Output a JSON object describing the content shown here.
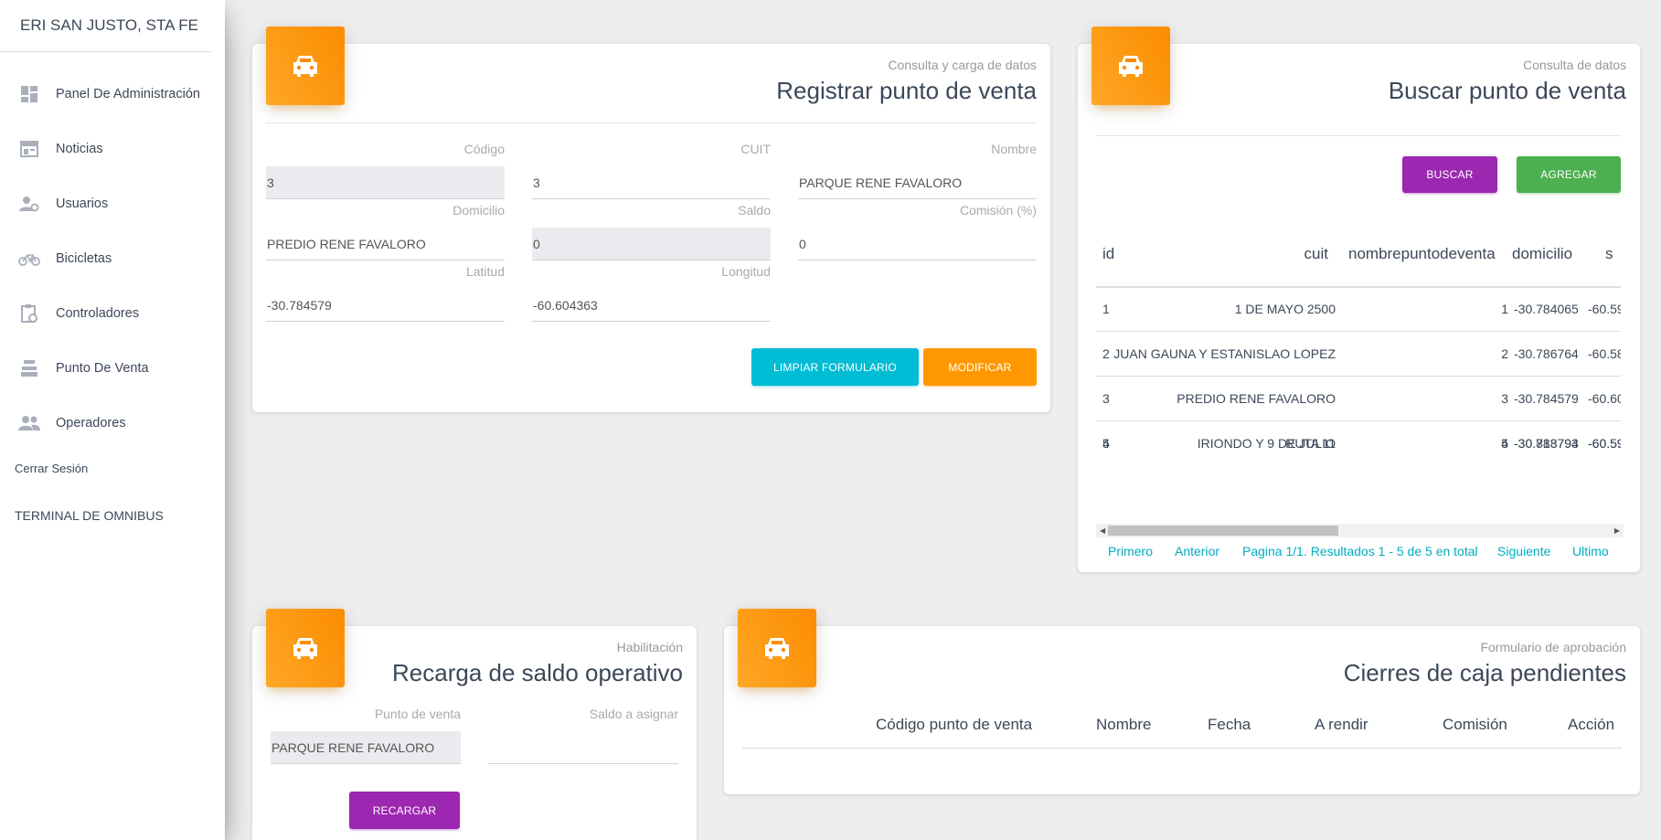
{
  "sidebar": {
    "brand": "ERI SAN JUSTO, STA FE",
    "items": [
      {
        "label": "Panel De Administración",
        "icon": "dashboard-icon"
      },
      {
        "label": "Noticias",
        "icon": "news-icon"
      },
      {
        "label": "Usuarios",
        "icon": "user-settings-icon"
      },
      {
        "label": "Bicicletas",
        "icon": "bicycle-icon"
      },
      {
        "label": "Controladores",
        "icon": "clipboard-clock-icon"
      },
      {
        "label": "Punto De Venta",
        "icon": "cash-register-icon"
      },
      {
        "label": "Operadores",
        "icon": "people-icon"
      }
    ],
    "logout": "Cerrar Sesión",
    "terminal": "TERMINAL DE OMNIBUS"
  },
  "registrar": {
    "category": "Consulta y carga de datos",
    "title": "Registrar punto de venta",
    "labels": {
      "codigo": "Código",
      "cuit": "CUIT",
      "nombre": "Nombre",
      "domicilio": "Domicilio",
      "saldo": "Saldo",
      "comision": "Comisión (%)",
      "latitud": "Latitud",
      "longitud": "Longitud"
    },
    "values": {
      "codigo": "3",
      "cuit": "3",
      "nombre": "PARQUE RENE FAVALORO",
      "domicilio": "PREDIO RENE FAVALORO",
      "saldo": "0",
      "comision": "0",
      "latitud": "-30.784579",
      "longitud": "-60.604363"
    },
    "clear_button": "LIMPIAR FORMULARIO",
    "modify_button": "MODIFICAR"
  },
  "buscar": {
    "category": "Consulta de datos",
    "title": "Buscar punto de venta",
    "search_button": "BUSCAR",
    "add_button": "AGREGAR",
    "columns": [
      "id",
      "cuit",
      "nombrepuntodeventa",
      "domicilio",
      "s"
    ],
    "rows": [
      [
        "1",
        "1 DE MAYO 2500",
        "1",
        "-30.784065",
        "-60.59"
      ],
      [
        "2",
        "JUAN GAUNA Y ESTANISLAO LOPEZ",
        "2",
        "-30.786764",
        "-60.58"
      ],
      [
        "3",
        "PREDIO RENE FAVALORO",
        "3",
        "-30.784579",
        "-60.60"
      ],
      [
        "4",
        "IRIONDO Y 9 DE JULIO",
        "4",
        "-30.788793",
        "-60.59"
      ],
      [
        "5",
        "RUTA 11",
        "5",
        "-30.813794",
        "-60.59"
      ]
    ],
    "pagination": {
      "first": "Primero",
      "prev": "Anterior",
      "info": "Pagina 1/1. Resultados 1 - 5 de 5 en total",
      "next": "Siguiente",
      "last": "Ultimo"
    }
  },
  "recarga": {
    "category": "Habilitación",
    "title": "Recarga de saldo operativo",
    "label_punto": "Punto de venta",
    "label_saldo": "Saldo a asignar",
    "punto_value": "PARQUE RENE FAVALORO",
    "saldo_value": "",
    "button": "RECARGAR"
  },
  "cierres": {
    "category": "Formulario de aprobación",
    "title": "Cierres de caja pendientes",
    "columns": [
      "Código punto de venta",
      "Nombre",
      "Fecha",
      "A rendir",
      "Comisión",
      "Acción"
    ]
  },
  "colors": {
    "accent_orange": "#ff9800",
    "info": "#00bcd4",
    "primary": "#9c27b0",
    "success": "#4caf50",
    "link": "#00acc1"
  }
}
